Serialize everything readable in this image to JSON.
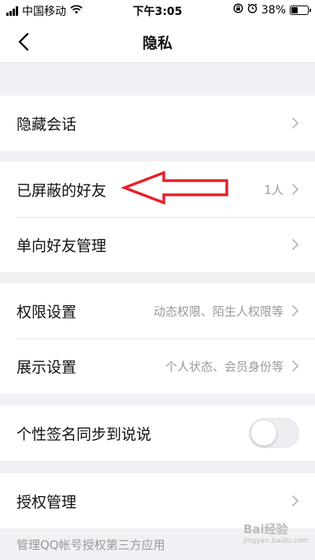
{
  "status_bar": {
    "carrier": "中国移动",
    "time": "下午3:05",
    "battery": "38%",
    "battery_level": 0.38
  },
  "nav": {
    "title": "隐私"
  },
  "rows": {
    "hidden_chats": {
      "label": "隐藏会话"
    },
    "blocked_friends": {
      "label": "已屏蔽的好友",
      "value": "1人"
    },
    "one_way_friends": {
      "label": "单向好友管理"
    },
    "permissions": {
      "label": "权限设置",
      "value": "动态权限、陌生人权限等"
    },
    "display": {
      "label": "展示设置",
      "value": "个人状态、会员身份等"
    },
    "signature_sync": {
      "label": "个性签名同步到说说",
      "toggle_on": false
    },
    "authorization": {
      "label": "授权管理"
    }
  },
  "footnote": "管理QQ帐号授权第三方应用",
  "watermark": {
    "main": "Bai经验",
    "sub": "jingyan.baidu.com"
  },
  "colors": {
    "background": "#f0f1f5",
    "arrow": "#e8202a",
    "secondary_text": "#999999"
  }
}
